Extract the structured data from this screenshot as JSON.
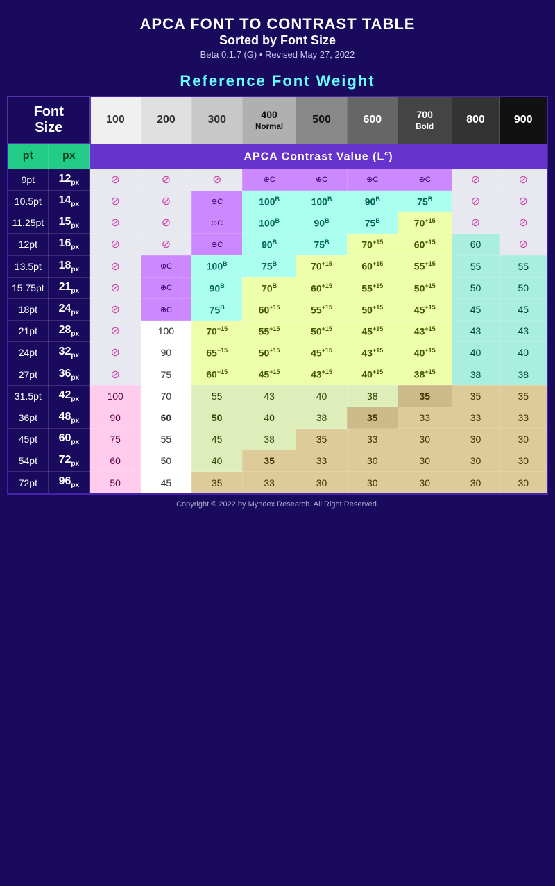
{
  "header": {
    "title": "APCA FONT TO CONTRAST TABLE",
    "subtitle": "Sorted by Font Size",
    "version": "Beta 0.1.7 (G) • Revised May 27, 2022"
  },
  "ref_weight": "Reference Font Weight",
  "weights": [
    "100",
    "200",
    "300",
    "400\nNormal",
    "500",
    "600",
    "700\nBold",
    "800",
    "900"
  ],
  "pt_label": "pt",
  "px_label": "px",
  "apca_label": "APCA Contrast Value (Lᶜ)",
  "footer": "Copyright © 2022 by Myndex Research. All Right Reserved."
}
